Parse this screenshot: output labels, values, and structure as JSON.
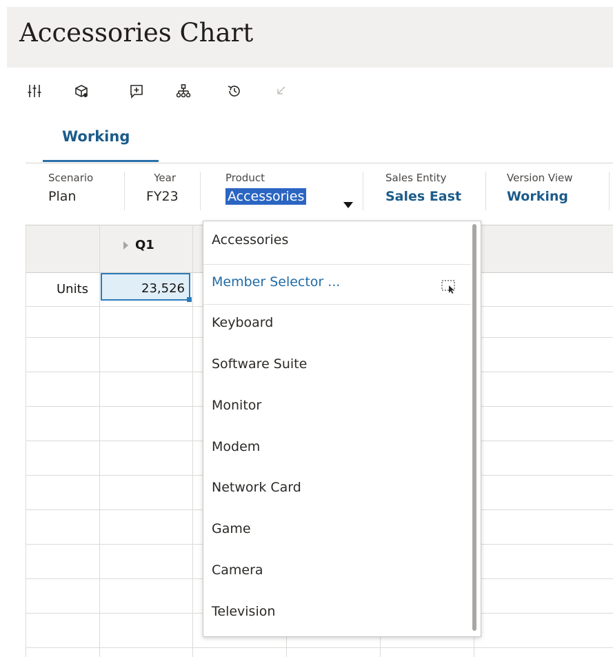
{
  "page": {
    "title": "Accessories Chart"
  },
  "toolbar": {
    "icons": [
      "sliders-icon",
      "cube-settings-icon",
      "add-comment-icon",
      "hierarchy-icon",
      "history-icon",
      "undo-icon"
    ]
  },
  "tab": {
    "label": "Working"
  },
  "pov": [
    {
      "label": "Scenario",
      "value": "Plan"
    },
    {
      "label": "Year",
      "value": "FY23"
    },
    {
      "label": "Product",
      "value": "Accessories"
    },
    {
      "label": "Sales Entity",
      "value": "Sales East"
    },
    {
      "label": "Version View",
      "value": "Working"
    }
  ],
  "grid": {
    "column_header": "Q1",
    "row_header": "Units",
    "cell_value": "23,526"
  },
  "dropdown": {
    "items": [
      "Accessories",
      "Member Selector ...",
      "Keyboard",
      "Software Suite",
      "Monitor",
      "Modem",
      "Network Card",
      "Game",
      "Camera",
      "Television"
    ]
  },
  "colors": {
    "accent": "#1b5b8a",
    "selection": "#2b65c2",
    "cell_highlight": "#e0eef8",
    "header_bg": "#f1f0ee"
  }
}
